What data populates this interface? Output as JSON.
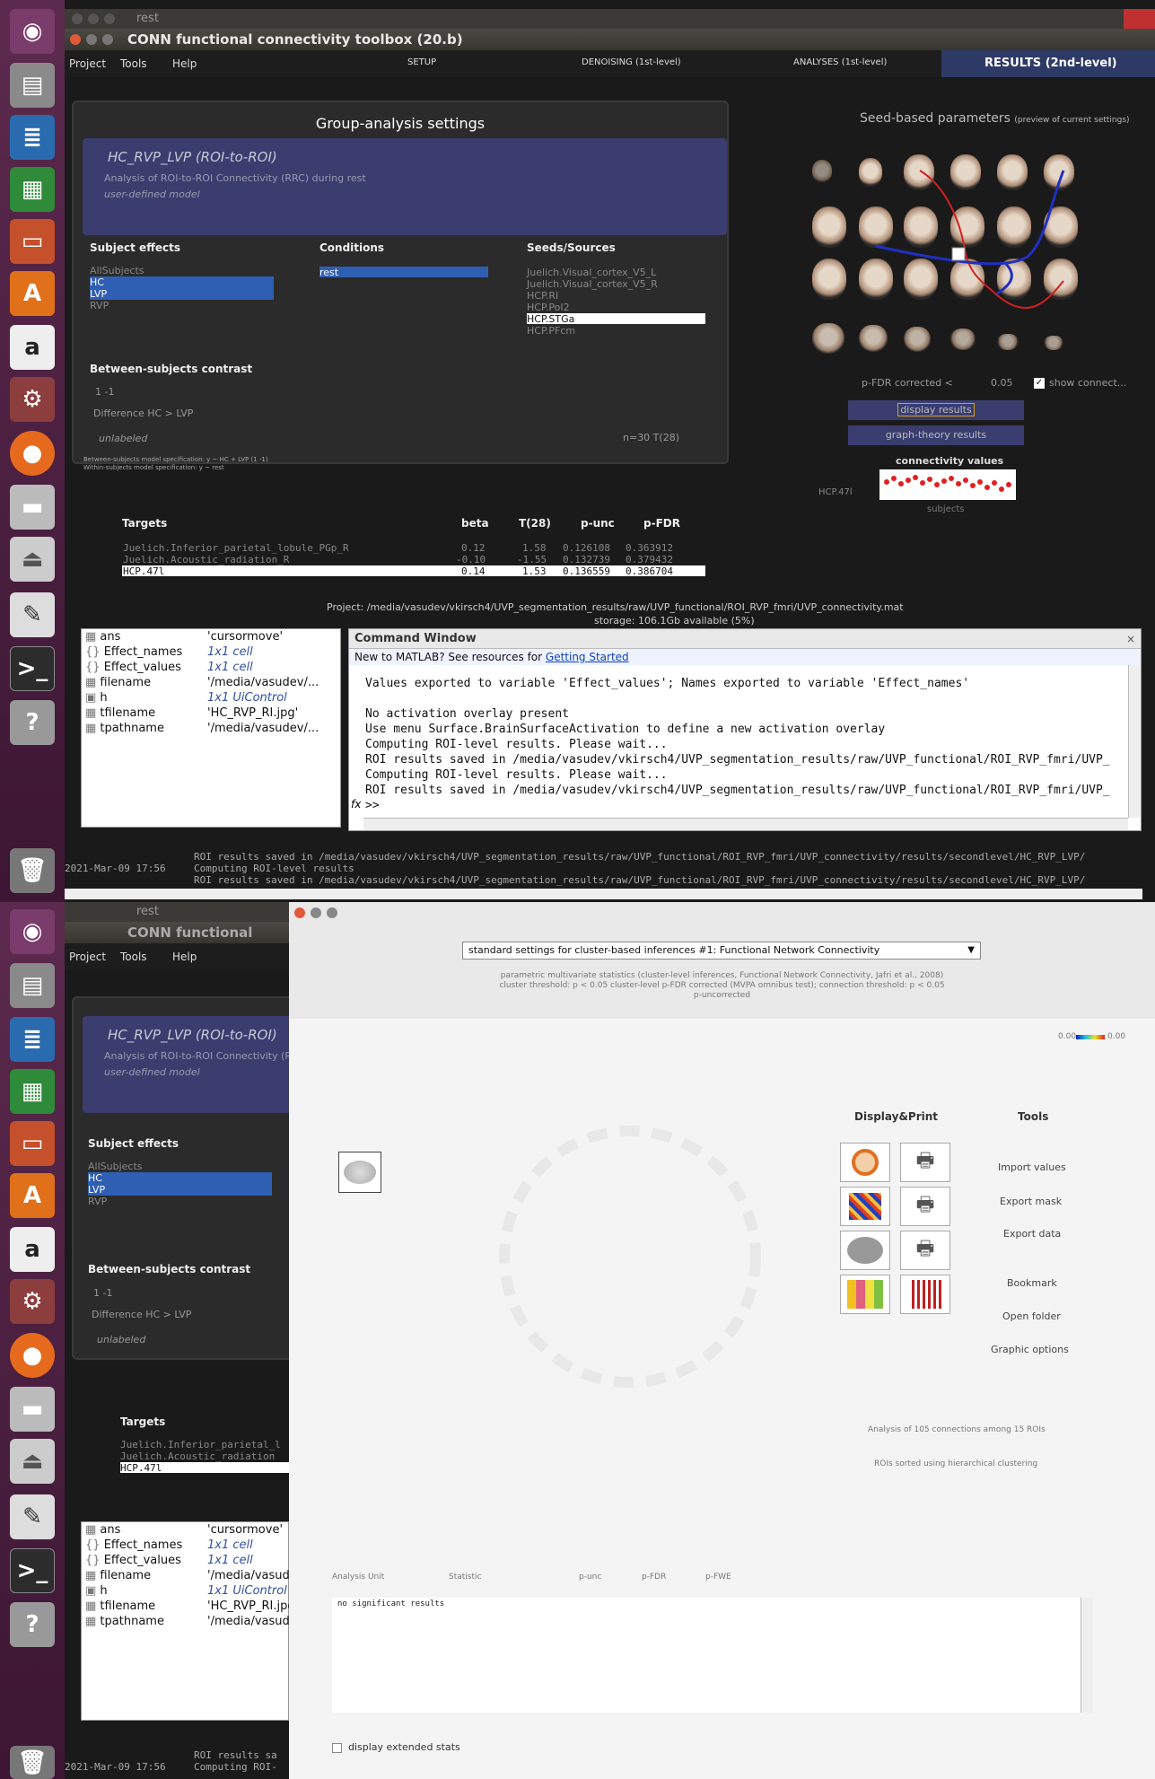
{
  "desktop": {
    "top_window_title": "rest",
    "bottom_window_title": "rest"
  },
  "conn": {
    "title": "CONN functional connectivity toolbox (20.b)",
    "title_partial": "CONN functional connect",
    "menu": [
      "Project",
      "Tools",
      "Help"
    ],
    "tabs": [
      "SETUP",
      "DENOISING (1st-level)",
      "ANALYSES (1st-level)",
      "RESULTS (2nd-level)"
    ],
    "group_title": "Group-analysis settings",
    "analysis_name": "HC_RVP_LVP (ROI-to-ROI)",
    "analysis_desc": "Analysis of ROI-to-ROI Connectivity (RRC) during rest",
    "model": "user-defined model",
    "subject_effects_label": "Subject effects",
    "subject_effects": [
      "AllSubjects",
      "HC",
      "LVP",
      "RVP"
    ],
    "conditions_label": "Conditions",
    "conditions": [
      "rest"
    ],
    "seeds_label": "Seeds/Sources",
    "seeds": [
      "Juelich.Visual_cortex_V5_L",
      "Juelich.Visual_cortex_V5_R",
      "HCP.RI",
      "HCP.PoI2",
      "HCP.STGa",
      "HCP.PFcm"
    ],
    "between_label": "Between-subjects contrast",
    "contrast_value": "1 -1",
    "contrast_desc": "Difference HC > LVP",
    "unlabeled": "unlabeled",
    "n_info": "n=30 T(28)",
    "spec1": "Between-subjects model specification: y ~ HC + LVP (1 -1)",
    "spec2": "Within-subjects model specification: y ~ rest",
    "seed_params": "Seed-based parameters",
    "seed_params_sub": "(preview of current settings)",
    "pfdr_label": "p-FDR corrected <",
    "pfdr_value": "0.05",
    "show_conn": "show connect...",
    "display_results": "display results",
    "graph_results": "graph-theory results",
    "conn_values": "connectivity values",
    "hcp_label": "HCP.47l",
    "subjects_label": "subjects",
    "targets_header": [
      "Targets",
      "beta",
      "T(28)",
      "p-unc",
      "p-FDR"
    ],
    "targets": [
      [
        "Juelich.Inferior_parietal_lobule_PGp_R",
        "0.12",
        "1.58",
        "0.126108",
        "0.363912"
      ],
      [
        "Juelich.Acoustic_radiation_R",
        "-0.10",
        "-1.55",
        "0.132739",
        "0.379432"
      ],
      [
        "HCP.47l",
        "0.14",
        "1.53",
        "0.136559",
        "0.386704"
      ]
    ],
    "targets_short": [
      "Juelich.Inferior_parietal_l",
      "Juelich.Acoustic_radiation",
      "HCP.47l"
    ],
    "project_path": "Project: /media/vasudev/vkirsch4/UVP_segmentation_results/raw/UVP_functional/ROI_RVP_fmri/UVP_connectivity.mat",
    "storage": "storage: 106.1Gb available (5%)"
  },
  "matlab": {
    "workspace": [
      [
        "ans",
        "'cursormove'"
      ],
      [
        "Effect_names",
        "1x1 cell"
      ],
      [
        "Effect_values",
        "1x1 cell"
      ],
      [
        "filename",
        "'/media/vasudev/..."
      ],
      [
        "h",
        "1x1 UiControl"
      ],
      [
        "tfilename",
        "'HC_RVP_RI.jpg'"
      ],
      [
        "tpathname",
        "'/media/vasudev/..."
      ]
    ],
    "cmd_title": "Command Window",
    "info_text": "New to MATLAB? See resources for",
    "info_link": "Getting Started",
    "lines": [
      "Values exported to variable 'Effect_values'; Names exported to variable 'Effect_names'",
      "",
      "No activation overlay present",
      "Use menu Surface.BrainSurfaceActivation to define a new activation overlay",
      "Computing ROI-level results. Please wait...",
      "ROI results saved in /media/vasudev/vkirsch4/UVP_segmentation_results/raw/UVP_functional/ROI_RVP_fmri/UVP_",
      "Computing ROI-level results. Please wait...",
      "ROI results saved in /media/vasudev/vkirsch4/UVP_segmentation_results/raw/UVP_functional/ROI_RVP_fmri/UVP_"
    ],
    "prompt": ">>",
    "hist_date": "2021-Mar-09 17:56",
    "hist1": "ROI results saved in /media/vasudev/vkirsch4/UVP_segmentation_results/raw/UVP_functional/ROI_RVP_fmri/UVP_connectivity/results/secondlevel/HC_RVP_LVP/",
    "hist2": "Computing ROI-level results",
    "hist3": "ROI results saved in /media/vasudev/vkirsch4/UVP_segmentation_results/raw/UVP_functional/ROI_RVP_fmri/UVP_connectivity/results/secondlevel/HC_RVP_LVP/",
    "hist2_short": "Computing ROI-",
    "hist3_short": "ROI results sa"
  },
  "results": {
    "dropdown": "standard settings for cluster-based inferences #1: Functional Network Connectivity",
    "desc1": "parametric multivariate statistics (cluster-level inferences, Functional Network Connectivity, Jafri et al., 2008)",
    "desc2": "cluster threshold: p < 0.05 cluster-level p-FDR corrected (MVPA omnibus test); connection threshold: p < 0.05",
    "desc3": "p-uncorrected",
    "colorbar_min": "0.00",
    "colorbar_max": "0.00",
    "display_print": "Display&Print",
    "tools_label": "Tools",
    "tools": [
      "Import values",
      "Export mask",
      "Export data",
      "Bookmark",
      "Open folder",
      "Graphic options"
    ],
    "analysis_info": "Analysis of 105 connections among 15 ROIs",
    "sort_info": "ROIs sorted using hierarchical clustering",
    "table_header": [
      "Analysis Unit",
      "Statistic",
      "p-unc",
      "p-FDR",
      "p-FWE"
    ],
    "no_results": "no significant results",
    "extended_stats": "display extended stats"
  },
  "colors": {
    "launcher": "#5c2a4e",
    "selection": "#2f5fb3",
    "header_box": "#3a3d6e",
    "results_tab": "#2e3a66"
  }
}
